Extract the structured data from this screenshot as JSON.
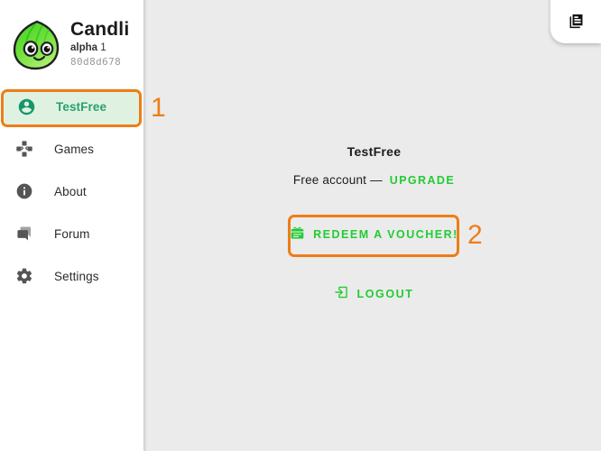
{
  "app": {
    "brand_name": "Candli",
    "version_channel": "alpha",
    "version_number": "1",
    "build_hash": "80d8d678",
    "logo_icon": "green-leaf-mascot-logo"
  },
  "sidebar": {
    "items": [
      {
        "label": "TestFree",
        "icon": "account-circle-icon",
        "active": true
      },
      {
        "label": "Games",
        "icon": "gamepad-dpad-icon",
        "active": false
      },
      {
        "label": "About",
        "icon": "info-circle-icon",
        "active": false
      },
      {
        "label": "Forum",
        "icon": "chat-bubbles-icon",
        "active": false
      },
      {
        "label": "Settings",
        "icon": "gear-icon",
        "active": false
      }
    ]
  },
  "main": {
    "account_name": "TestFree",
    "account_type_text": "Free account —",
    "upgrade_label": "UPGRADE",
    "voucher_label": "REDEEM A VOUCHER!",
    "voucher_icon": "gift-card-redeem-icon",
    "logout_label": "LOGOUT",
    "logout_icon": "exit-arrow-icon"
  },
  "corner": {
    "icon": "library-documents-icon"
  },
  "annotations": [
    {
      "number": "1",
      "target": "sidebar-item-testfree"
    },
    {
      "number": "2",
      "target": "redeem-voucher-button"
    }
  ],
  "colors": {
    "accent_green": "#22cc33",
    "active_green_text": "#2aa06f",
    "active_green_bg": "#dff2e2",
    "annotation_orange": "#ee7d17",
    "sidebar_bg": "#ffffff",
    "main_bg": "#ebebeb",
    "icon_gray": "#555555"
  }
}
